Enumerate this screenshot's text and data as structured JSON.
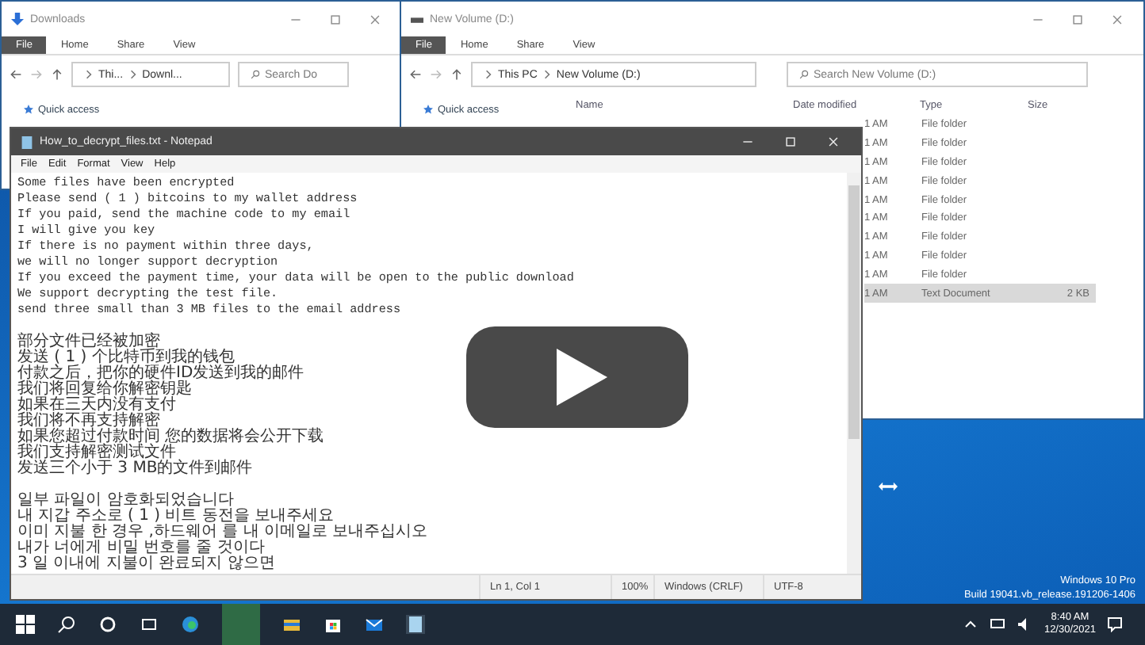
{
  "downloads_window": {
    "title": "Downloads",
    "ribbon_tabs": [
      {
        "label": "File",
        "kind": "file"
      },
      {
        "label": "Home",
        "kind": "tab"
      },
      {
        "label": "Share",
        "kind": "tab"
      },
      {
        "label": "View",
        "kind": "tab"
      }
    ],
    "breadcrumb": [
      "Thi...",
      "Downl..."
    ],
    "search_placeholder": "Search Do",
    "nav_item": "Quick access"
  },
  "volume_window": {
    "title": "New Volume (D:)",
    "ribbon_tabs": [
      {
        "label": "File",
        "kind": "file"
      },
      {
        "label": "Home",
        "kind": "tab"
      },
      {
        "label": "Share",
        "kind": "tab"
      },
      {
        "label": "View",
        "kind": "tab"
      }
    ],
    "breadcrumb": [
      "This PC",
      "New Volume (D:)"
    ],
    "search_placeholder": "Search New Volume (D:)",
    "nav_item": "Quick access",
    "columns": [
      "Name",
      "Date modified",
      "Type",
      "Size"
    ],
    "rows": [
      {
        "modified": "1 AM",
        "type": "File folder",
        "selected": false
      },
      {
        "modified": "1 AM",
        "type": "File folder",
        "selected": false
      },
      {
        "modified": "1 AM",
        "type": "File folder",
        "selected": false
      },
      {
        "modified": "1 AM",
        "type": "File folder",
        "selected": false
      },
      {
        "modified": "1 AM",
        "type": "File folder",
        "selected": false
      },
      {
        "modified": "1 AM",
        "type": "File folder",
        "selected": false
      },
      {
        "modified": "1 AM",
        "type": "File folder",
        "selected": false
      },
      {
        "modified": "1 AM",
        "type": "File folder",
        "selected": false
      },
      {
        "modified": "1 AM",
        "type": "File folder",
        "selected": false
      },
      {
        "modified": "1 AM",
        "type": "Text Document",
        "size": "2 KB",
        "selected": true
      }
    ]
  },
  "notepad": {
    "title": "How_to_decrypt_files.txt - Notepad",
    "menu": [
      "File",
      "Edit",
      "Format",
      "View",
      "Help"
    ],
    "paragraphs": [
      [
        "Some files have been encrypted",
        "Please send ( 1 ) bitcoins to my wallet address",
        "If you paid, send the machine code to my email",
        "I will give you key",
        "If there is no payment within three days,",
        "we will no longer support decryption",
        "If you exceed the payment time, your data will be open to the public download",
        "We support decrypting the test file.",
        "send three small than 3 MB files to the email address"
      ],
      [
        "部分文件已经被加密",
        "发送 ( 1 ) 个比特币到我的钱包",
        "付款之后，把你的硬件ID发送到我的邮件",
        "我们将回复给你解密钥匙",
        "如果在三天内没有支付",
        "我们将不再支持解密",
        "如果您超过付款时间 您的数据将会公开下载",
        "我们支持解密测试文件",
        "发送三个小于 3 MB的文件到邮件"
      ],
      [
        "일부 파일이 암호화되었습니다",
        "내 지갑 주소로 ( 1 ) 비트 동전을 보내주세요",
        "이미 지불 한 경우 ,하드웨어 를 내 이메일로 보내주십시오",
        "내가 너에게 비밀 번호를 줄 것이다",
        "3 일 이내에 지불이 완료되지 않으면"
      ]
    ],
    "status": [
      "Ln 1, Col 1",
      "100%",
      "Windows (CRLF)",
      "UTF-8"
    ]
  },
  "desktop": {
    "edition": "Windows 10 Pro",
    "build": "Build 19041.vb_release.191206-1406"
  },
  "taskbar": {
    "time": "8:40 AM",
    "date": "12/30/2021"
  }
}
